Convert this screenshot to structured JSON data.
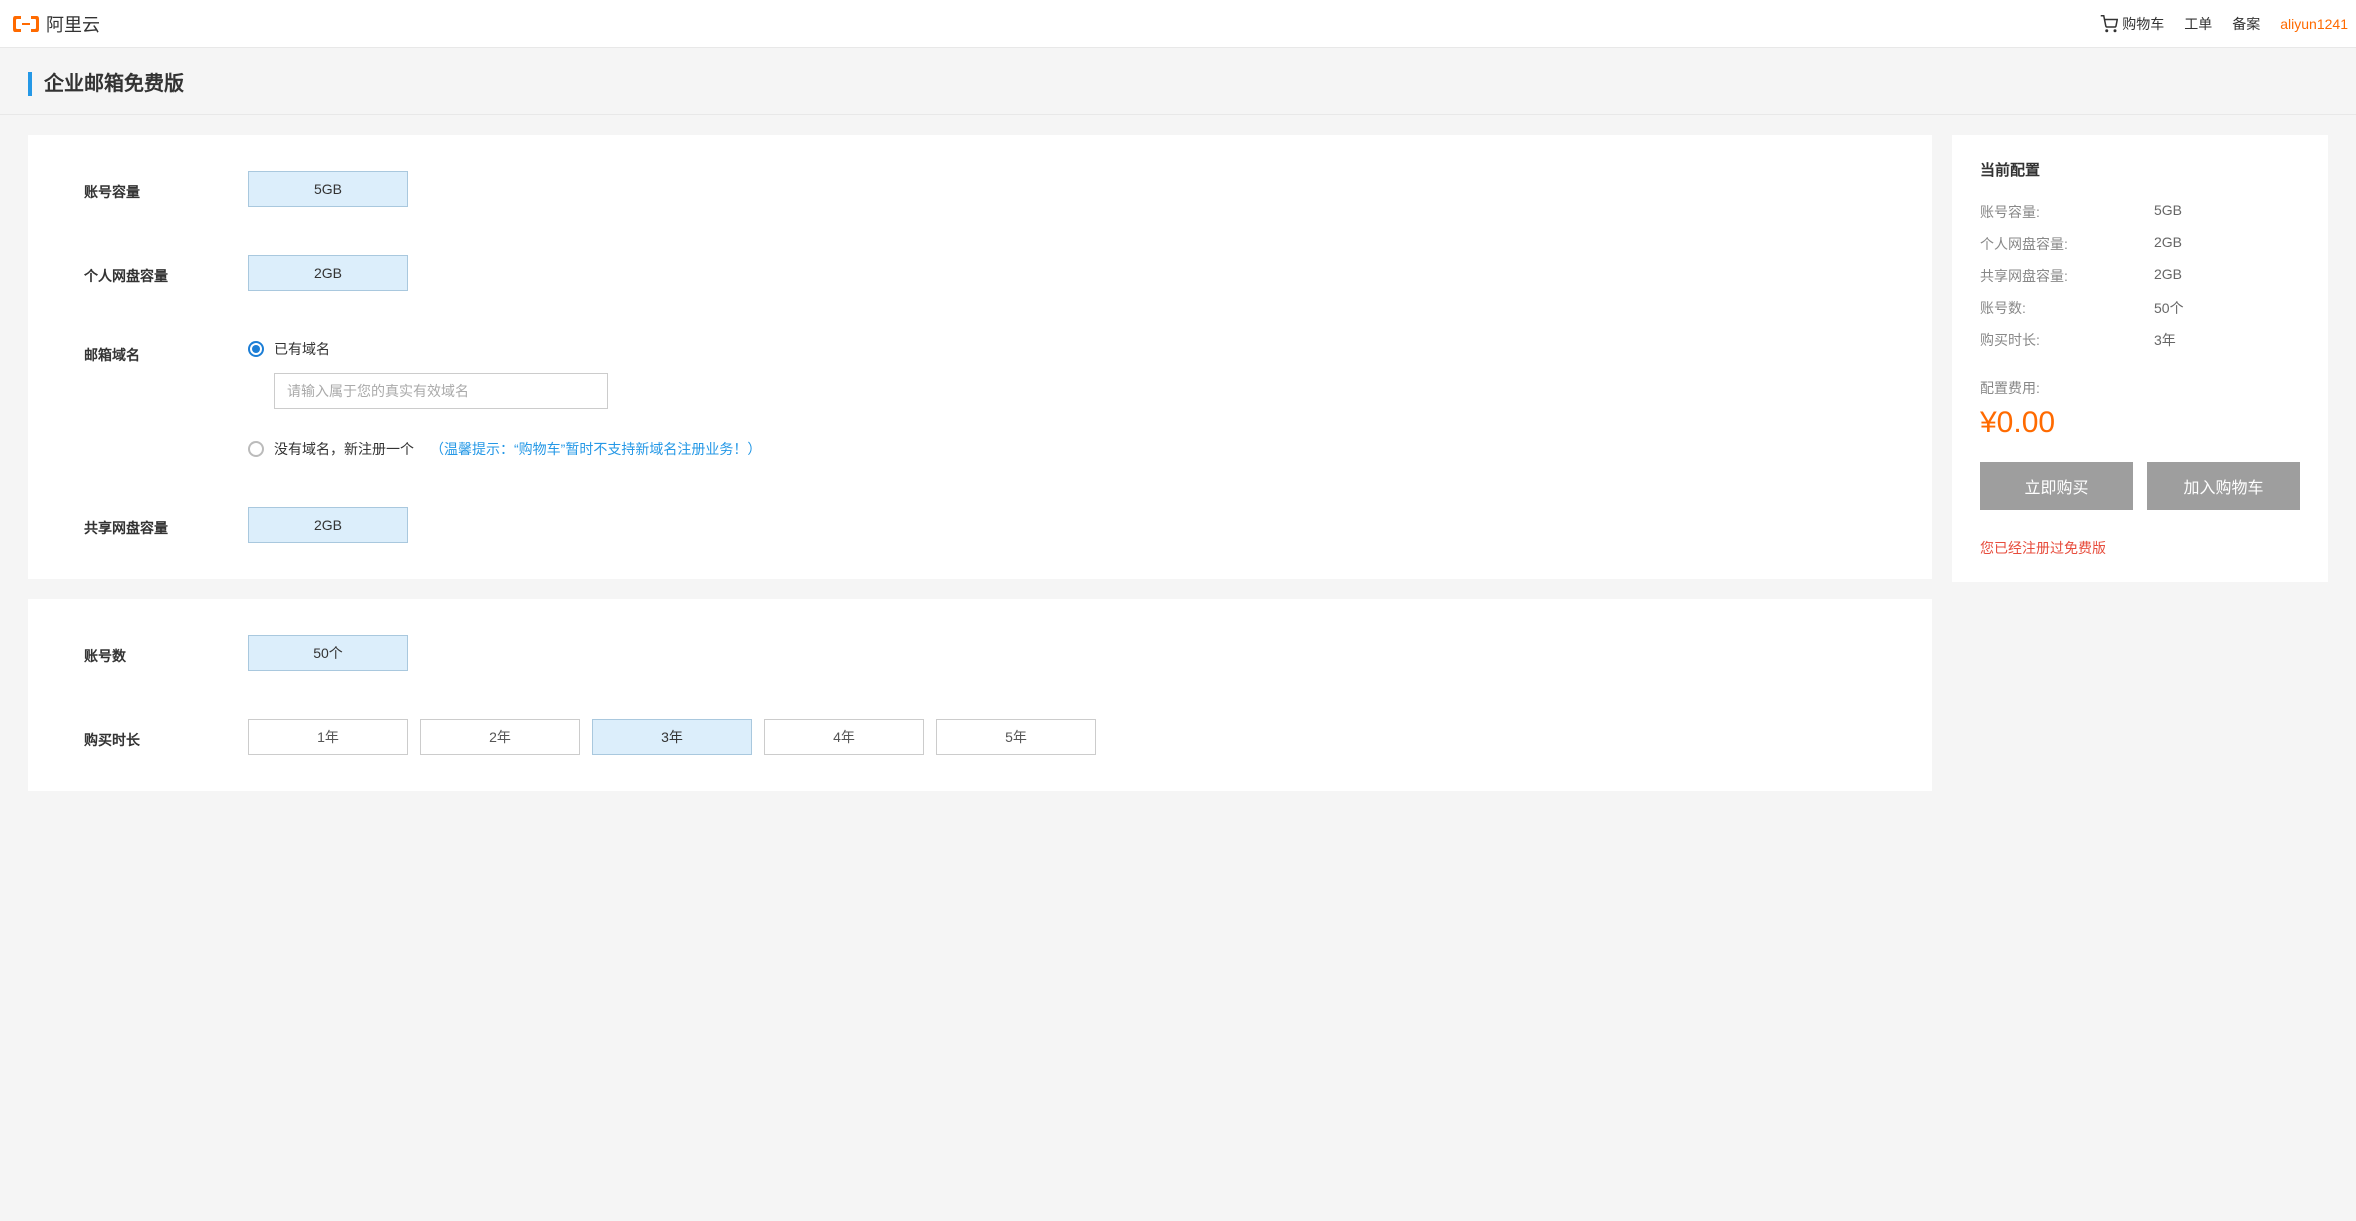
{
  "header": {
    "logo_text": "阿里云",
    "cart": "购物车",
    "ticket": "工单",
    "beian": "备案",
    "username": "aliyun1241"
  },
  "page_title": "企业邮箱免费版",
  "form": {
    "account_capacity": {
      "label": "账号容量",
      "value": "5GB"
    },
    "personal_netdisk": {
      "label": "个人网盘容量",
      "value": "2GB"
    },
    "mail_domain": {
      "label": "邮箱域名",
      "has_domain_label": "已有域名",
      "input_placeholder": "请输入属于您的真实有效域名",
      "no_domain_label": "没有域名，新注册一个",
      "hint": "（温馨提示：“购物车”暂时不支持新域名注册业务！）"
    },
    "shared_netdisk": {
      "label": "共享网盘容量",
      "value": "2GB"
    },
    "account_count": {
      "label": "账号数",
      "value": "50个"
    },
    "duration": {
      "label": "购买时长",
      "options": [
        "1年",
        "2年",
        "3年",
        "4年",
        "5年"
      ],
      "selected_index": 2
    }
  },
  "sidebar": {
    "title": "当前配置",
    "rows": [
      {
        "label": "账号容量:",
        "value": "5GB"
      },
      {
        "label": "个人网盘容量:",
        "value": "2GB"
      },
      {
        "label": "共享网盘容量:",
        "value": "2GB"
      },
      {
        "label": "账号数:",
        "value": "50个"
      },
      {
        "label": "购买时长:",
        "value": "3年"
      }
    ],
    "fee_label": "配置费用:",
    "price": "¥0.00",
    "buy_now": "立即购买",
    "add_cart": "加入购物车",
    "warn": "您已经注册过免费版"
  }
}
